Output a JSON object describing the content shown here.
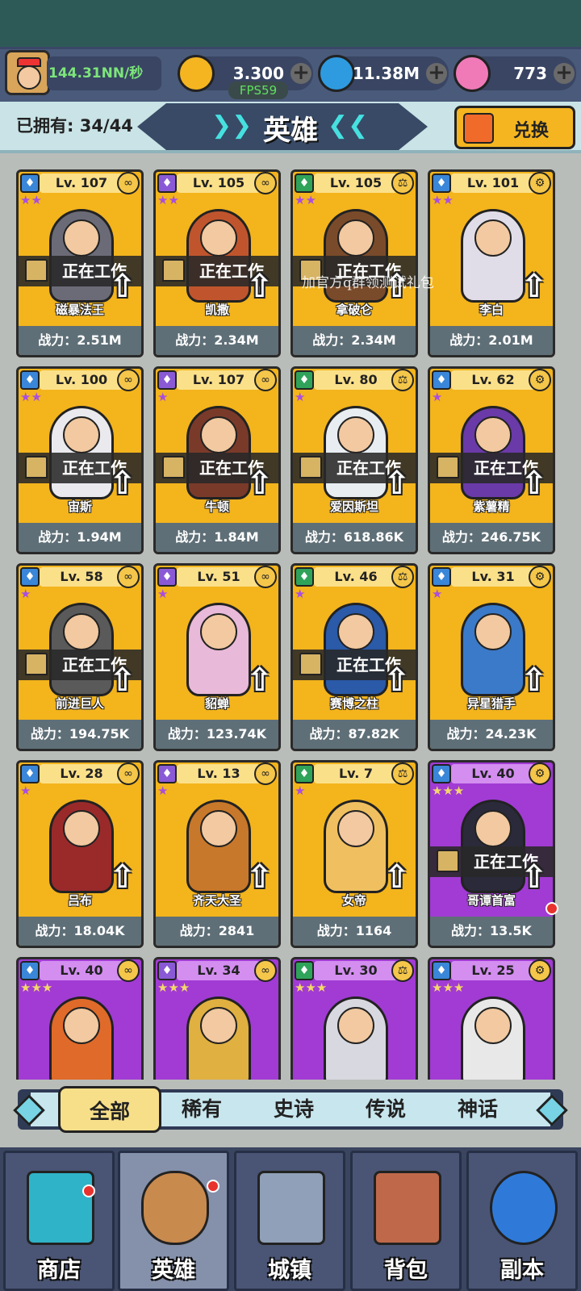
{
  "header": {
    "income_rate": "144.31NN/秒",
    "fps": "FPS59",
    "resources": [
      {
        "icon": "crown-icon",
        "value": "3.300",
        "color": "#f4b521"
      },
      {
        "icon": "spiral-gem-icon",
        "value": "11.38M",
        "color": "#2e9be0"
      },
      {
        "icon": "candy-icon",
        "value": "773",
        "color": "#f07ab8"
      }
    ]
  },
  "titlebar": {
    "owned": "已拥有: 34/44",
    "title": "英雄",
    "redeem_label": "兑换"
  },
  "watermark": "加官方q群领测试礼包",
  "working_label": "正在工作",
  "heroes": [
    {
      "name": "磁暴法王",
      "level": "Lv. 107",
      "power": "战力：2.51M",
      "working": true,
      "rarity": "gold",
      "stars": "★★"
    },
    {
      "name": "凯撒",
      "level": "Lv. 105",
      "power": "战力：2.34M",
      "working": true,
      "rarity": "gold",
      "stars": "★★"
    },
    {
      "name": "拿破仑",
      "level": "Lv. 105",
      "power": "战力：2.34M",
      "working": true,
      "rarity": "gold",
      "stars": "★★"
    },
    {
      "name": "李白",
      "level": "Lv. 101",
      "power": "战力：2.01M",
      "working": false,
      "rarity": "gold",
      "stars": "★★"
    },
    {
      "name": "宙斯",
      "level": "Lv. 100",
      "power": "战力：1.94M",
      "working": true,
      "rarity": "gold",
      "stars": "★★"
    },
    {
      "name": "牛顿",
      "level": "Lv. 107",
      "power": "战力：1.84M",
      "working": true,
      "rarity": "gold",
      "stars": "★"
    },
    {
      "name": "爱因斯坦",
      "level": "Lv. 80",
      "power": "战力：618.86K",
      "working": true,
      "rarity": "gold",
      "stars": "★"
    },
    {
      "name": "紫薯精",
      "level": "Lv. 62",
      "power": "战力：246.75K",
      "working": true,
      "rarity": "gold",
      "stars": "★"
    },
    {
      "name": "前进巨人",
      "level": "Lv. 58",
      "power": "战力：194.75K",
      "working": true,
      "rarity": "gold",
      "stars": "★"
    },
    {
      "name": "貂蝉",
      "level": "Lv. 51",
      "power": "战力：123.74K",
      "working": false,
      "rarity": "gold",
      "stars": "★"
    },
    {
      "name": "赛博之柱",
      "level": "Lv. 46",
      "power": "战力：87.82K",
      "working": true,
      "rarity": "gold",
      "stars": "★"
    },
    {
      "name": "异星猎手",
      "level": "Lv. 31",
      "power": "战力：24.23K",
      "working": false,
      "rarity": "gold",
      "stars": "★"
    },
    {
      "name": "吕布",
      "level": "Lv. 28",
      "power": "战力：18.04K",
      "working": false,
      "rarity": "gold",
      "stars": "★"
    },
    {
      "name": "齐天大圣",
      "level": "Lv. 13",
      "power": "战力：2841",
      "working": false,
      "rarity": "gold",
      "stars": "★"
    },
    {
      "name": "女帝",
      "level": "Lv. 7",
      "power": "战力：1164",
      "working": false,
      "rarity": "gold",
      "stars": "★"
    },
    {
      "name": "哥谭首富",
      "level": "Lv. 40",
      "power": "战力：13.5K",
      "working": true,
      "rarity": "purple",
      "stars": "★★★"
    },
    {
      "name": "",
      "level": "Lv. 40",
      "power": "",
      "working": false,
      "rarity": "purple",
      "stars": "★★★"
    },
    {
      "name": "",
      "level": "Lv. 34",
      "power": "",
      "working": false,
      "rarity": "purple",
      "stars": "★★★"
    },
    {
      "name": "",
      "level": "Lv. 30",
      "power": "",
      "working": false,
      "rarity": "purple",
      "stars": "★★★"
    },
    {
      "name": "",
      "level": "Lv. 25",
      "power": "",
      "working": false,
      "rarity": "purple",
      "stars": "★★★"
    }
  ],
  "filter_tabs": [
    "全部",
    "稀有",
    "史诗",
    "传说",
    "神话"
  ],
  "bottom_nav": [
    "商店",
    "英雄",
    "城镇",
    "背包",
    "副本"
  ]
}
